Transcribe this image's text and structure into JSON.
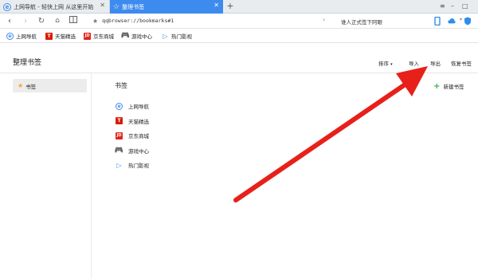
{
  "tabs": [
    {
      "label": "上网导航 - 轻快上网 从这里开始",
      "active": false
    },
    {
      "label": "整理书签",
      "active": true
    }
  ],
  "new_tab_symbol": "+",
  "address_bar": {
    "url": "qqbrowser://bookmarks#1"
  },
  "search_box": {
    "text": "谁人正式签下阿眼"
  },
  "bookmarks_bar": [
    {
      "label": "上网导航",
      "icon": "ie-e-icon"
    },
    {
      "label": "天猫精选",
      "icon": "tmall-icon"
    },
    {
      "label": "京东商城",
      "icon": "jd-icon"
    },
    {
      "label": "游戏中心",
      "icon": "gamepad-icon"
    },
    {
      "label": "热门影视",
      "icon": "play-icon"
    }
  ],
  "page": {
    "title": "整理书签",
    "actions": {
      "sort": "排序",
      "import": "导入",
      "export": "导出",
      "restore": "恢复书签"
    },
    "sidebar": {
      "folder": "书签"
    },
    "main_title": "书签",
    "new_bookmark": "新建书签",
    "items": [
      {
        "label": "上网导航",
        "icon": "ie-e-icon"
      },
      {
        "label": "天猫精选",
        "icon": "tmall-icon"
      },
      {
        "label": "京东商城",
        "icon": "jd-icon"
      },
      {
        "label": "游戏中心",
        "icon": "gamepad-icon"
      },
      {
        "label": "热门影视",
        "icon": "play-icon"
      }
    ]
  },
  "colors": {
    "accent": "#3d8bef",
    "annotation_arrow": "#e8201a",
    "tmall": "#d81e06",
    "jd": "#e1251b",
    "game": "#4caf50"
  }
}
